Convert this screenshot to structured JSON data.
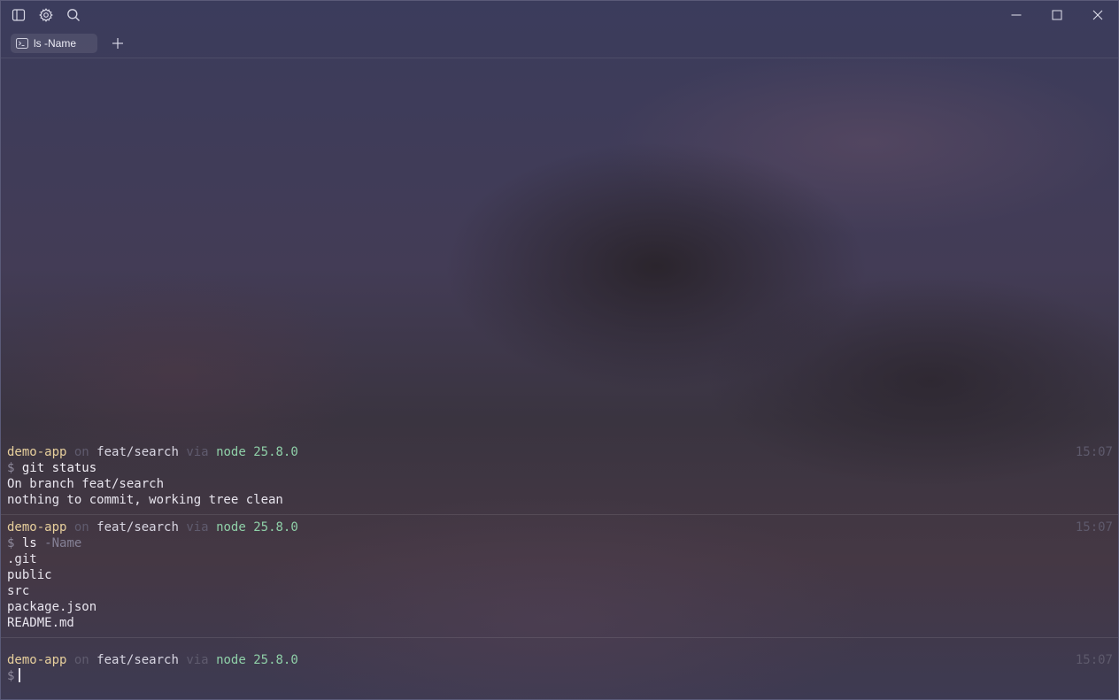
{
  "titlebar": {
    "icons": [
      "sidebar-toggle-icon",
      "settings-gear-icon",
      "search-icon"
    ],
    "window_controls": [
      "minimize-icon",
      "maximize-icon",
      "close-icon"
    ]
  },
  "tabs": [
    {
      "label": "ls -Name",
      "icon": "terminal-icon",
      "active": true
    }
  ],
  "new_tab_icon": "plus-icon",
  "blocks": [
    {
      "prompt": {
        "dir": "demo-app",
        "on": "on",
        "branch": "feat/search",
        "via": "via",
        "runtime": "node 25.8.0",
        "time": "15:07"
      },
      "dollar": "$",
      "command": "git status",
      "args": "",
      "output": [
        "On branch feat/search",
        "nothing to commit, working tree clean"
      ]
    },
    {
      "prompt": {
        "dir": "demo-app",
        "on": "on",
        "branch": "feat/search",
        "via": "via",
        "runtime": "node 25.8.0",
        "time": "15:07"
      },
      "dollar": "$",
      "command": "ls",
      "args": "-Name",
      "output": [
        ".git",
        "public",
        "src",
        "package.json",
        "README.md"
      ]
    }
  ],
  "active_prompt": {
    "dir": "demo-app",
    "on": "on",
    "branch": "feat/search",
    "via": "via",
    "runtime": "node 25.8.0",
    "time": "15:07",
    "dollar": "$",
    "input": ""
  },
  "colors": {
    "dir": "#e7cf9c",
    "runtime": "#8fd0a8",
    "dim": "#5f5b6e"
  }
}
